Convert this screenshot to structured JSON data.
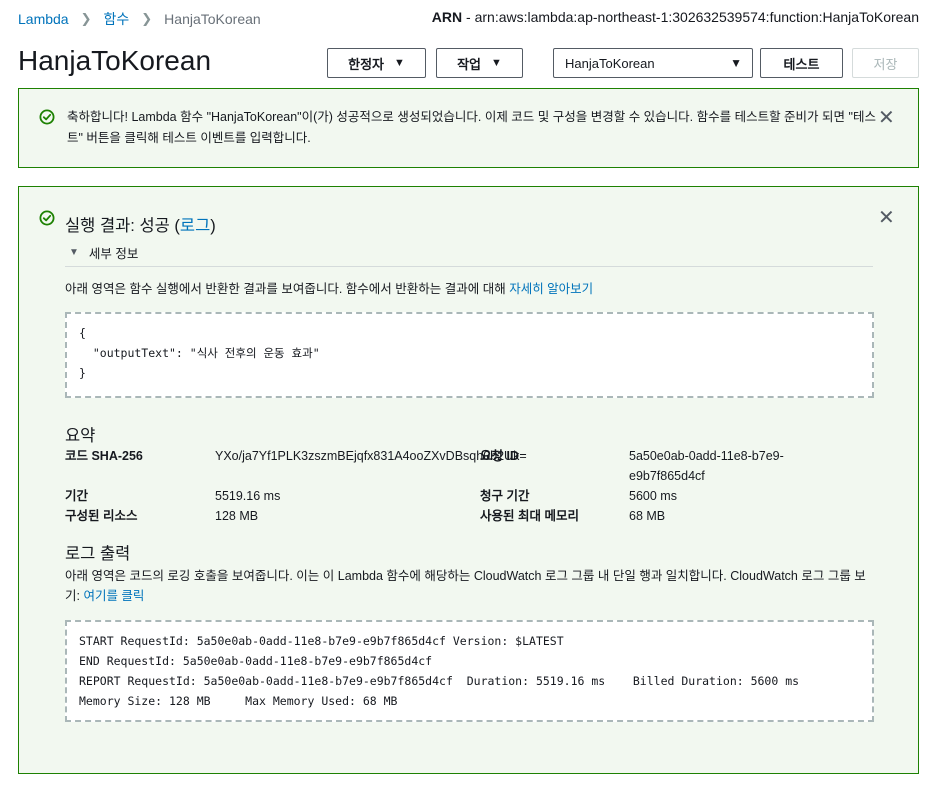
{
  "breadcrumb": {
    "root": "Lambda",
    "functions": "함수",
    "current": "HanjaToKorean"
  },
  "arn": {
    "label": "ARN",
    "value": " - arn:aws:lambda:ap-northeast-1:302632539574:function:HanjaToKorean"
  },
  "header": {
    "title": "HanjaToKorean",
    "qualifiers_label": "한정자",
    "actions_label": "작업",
    "test_event_selected": "HanjaToKorean",
    "test_label": "테스트",
    "save_label": "저장"
  },
  "banner": {
    "message": "축하합니다! Lambda 함수 \"HanjaToKorean\"이(가) 성공적으로 생성되었습니다. 이제 코드 및 구성을 변경할 수 있습니다. 함수를 테스트할 준비가 되면 \"테스트\" 버튼을 클릭해 테스트 이벤트를 입력합니다."
  },
  "result": {
    "title_prefix": "실행 결과: 성공 (",
    "title_link": "로그",
    "title_suffix": ")",
    "details_label": "세부 정보",
    "description": "아래 영역은 함수 실행에서 반환한 결과를 보여줍니다. 함수에서 반환하는 결과에 대해 ",
    "learn_more": "자세히 알아보기",
    "output_code": "{\n  \"outputText\": \"식사 전후의 운동 효과\"\n}"
  },
  "summary": {
    "heading": "요약",
    "code_sha_label": "코드 SHA-256",
    "code_sha_value": "YXo/ja7Yf1PLK3zszmBEjqfx831A4ooZXvDBsqh0b2Uk=",
    "request_id_label": "요청 ID",
    "request_id_value_line1": "5a50e0ab-0add-11e8-b7e9-",
    "request_id_value_line2": "e9b7f865d4cf",
    "duration_label": "기간",
    "duration_value": "5519.16 ms",
    "billed_label": "청구 기간",
    "billed_value": "5600 ms",
    "resources_label": "구성된 리소스",
    "resources_value": "128 MB",
    "max_memory_label": "사용된 최대 메모리",
    "max_memory_value": "68 MB"
  },
  "log": {
    "heading": "로그 출력",
    "description": "아래 영역은 코드의 로깅 호출을 보여줍니다. 이는 이 Lambda 함수에 해당하는 CloudWatch 로그 그룹 내 단일 행과 일치합니다. CloudWatch 로그 그룹 보기: ",
    "click_here": "여기를 클릭",
    "output": "START RequestId: 5a50e0ab-0add-11e8-b7e9-e9b7f865d4cf Version: $LATEST\nEND RequestId: 5a50e0ab-0add-11e8-b7e9-e9b7f865d4cf\nREPORT RequestId: 5a50e0ab-0add-11e8-b7e9-e9b7f865d4cf  Duration: 5519.16 ms    Billed Duration: 5600 ms\nMemory Size: 128 MB     Max Memory Used: 68 MB"
  },
  "colors": {
    "success_green": "#1d8102",
    "success_bg": "#f2f8f0",
    "link_blue": "#0073bb"
  },
  "icons": {
    "success": "check-circle-icon",
    "close": "close-icon",
    "caret": "caret-down-icon",
    "breadcrumb_sep": "chevron-right-icon",
    "expand": "triangle-down-icon"
  }
}
